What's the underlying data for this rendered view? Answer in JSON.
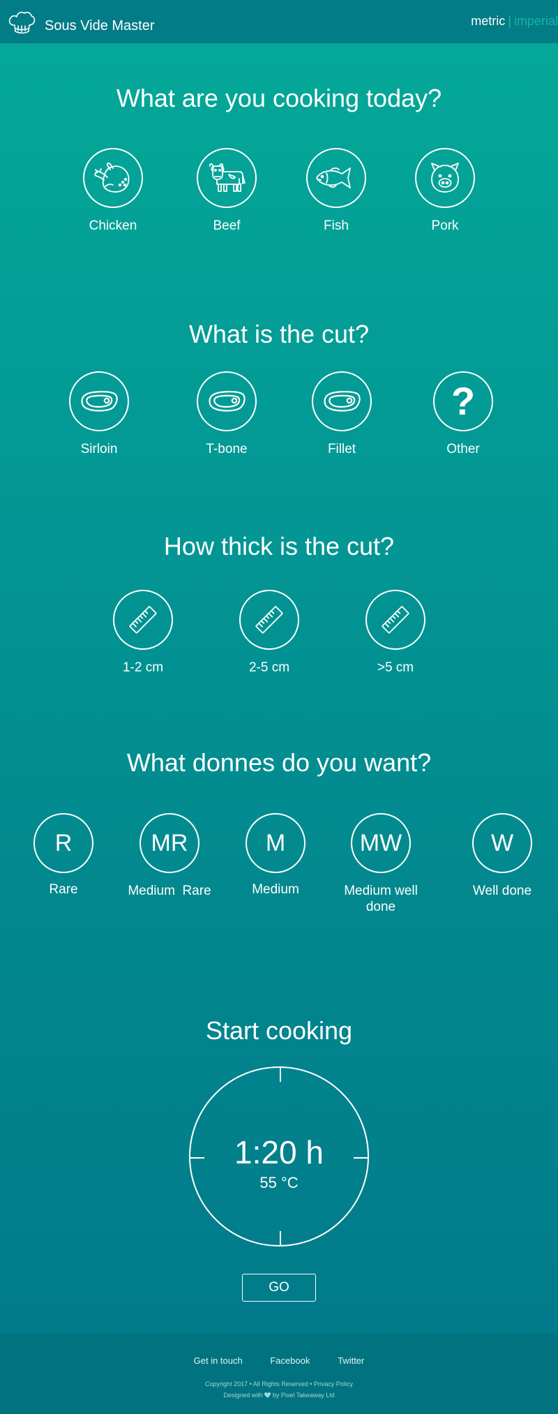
{
  "header": {
    "brand": "Sous Vide Master",
    "logo_icon": "chef-hat-icon",
    "units": {
      "metric": "metric",
      "separator": "|",
      "imperial": "imperial",
      "selected": "metric"
    }
  },
  "food": {
    "title": "What are you cooking today?",
    "options": [
      {
        "label": "Chicken",
        "icon": "chicken-icon"
      },
      {
        "label": "Beef",
        "icon": "cow-icon"
      },
      {
        "label": "Fish",
        "icon": "fish-icon"
      },
      {
        "label": "Pork",
        "icon": "pig-icon"
      }
    ]
  },
  "cut": {
    "title": "What is the cut?",
    "options": [
      {
        "label": "Sirloin",
        "icon": "steak-icon"
      },
      {
        "label": "T-bone",
        "icon": "steak-icon"
      },
      {
        "label": "Fillet",
        "icon": "steak-icon"
      },
      {
        "label": "Other",
        "icon": "question-mark",
        "glyph": "?"
      }
    ]
  },
  "thickness": {
    "title": "How thick is the cut?",
    "options": [
      {
        "label": "1-2 cm",
        "icon": "ruler-icon"
      },
      {
        "label": "2-5 cm",
        "icon": "ruler-icon"
      },
      {
        "label": ">5 cm",
        "icon": "ruler-icon"
      }
    ]
  },
  "doneness": {
    "title": "What donnes do you want?",
    "options": [
      {
        "letter": "R",
        "label": "Rare"
      },
      {
        "letter": "MR",
        "label": "Medium  Rare"
      },
      {
        "letter": "M",
        "label": "Medium"
      },
      {
        "letter": "MW",
        "label": "Medium well done"
      },
      {
        "letter": "W",
        "label": "Well done"
      }
    ]
  },
  "cooking": {
    "title": "Start cooking",
    "time": "1:20 h",
    "temperature": "55 °C",
    "go_label": "GO"
  },
  "footer": {
    "links": [
      "Get in touch",
      "Facebook",
      "Twitter"
    ],
    "copyright": "Copyright 2017 • All Rights Reserved • Privacy Policy",
    "designed_prefix": "Designed with",
    "designed_suffix": "by Pixel Takeaway Ltd"
  },
  "colors": {
    "gradient_top": "#05a998",
    "gradient_bottom": "#01788a",
    "header_bg": "#027c87",
    "footer_bg": "#01727f",
    "imperial_text": "#15b4a6"
  }
}
